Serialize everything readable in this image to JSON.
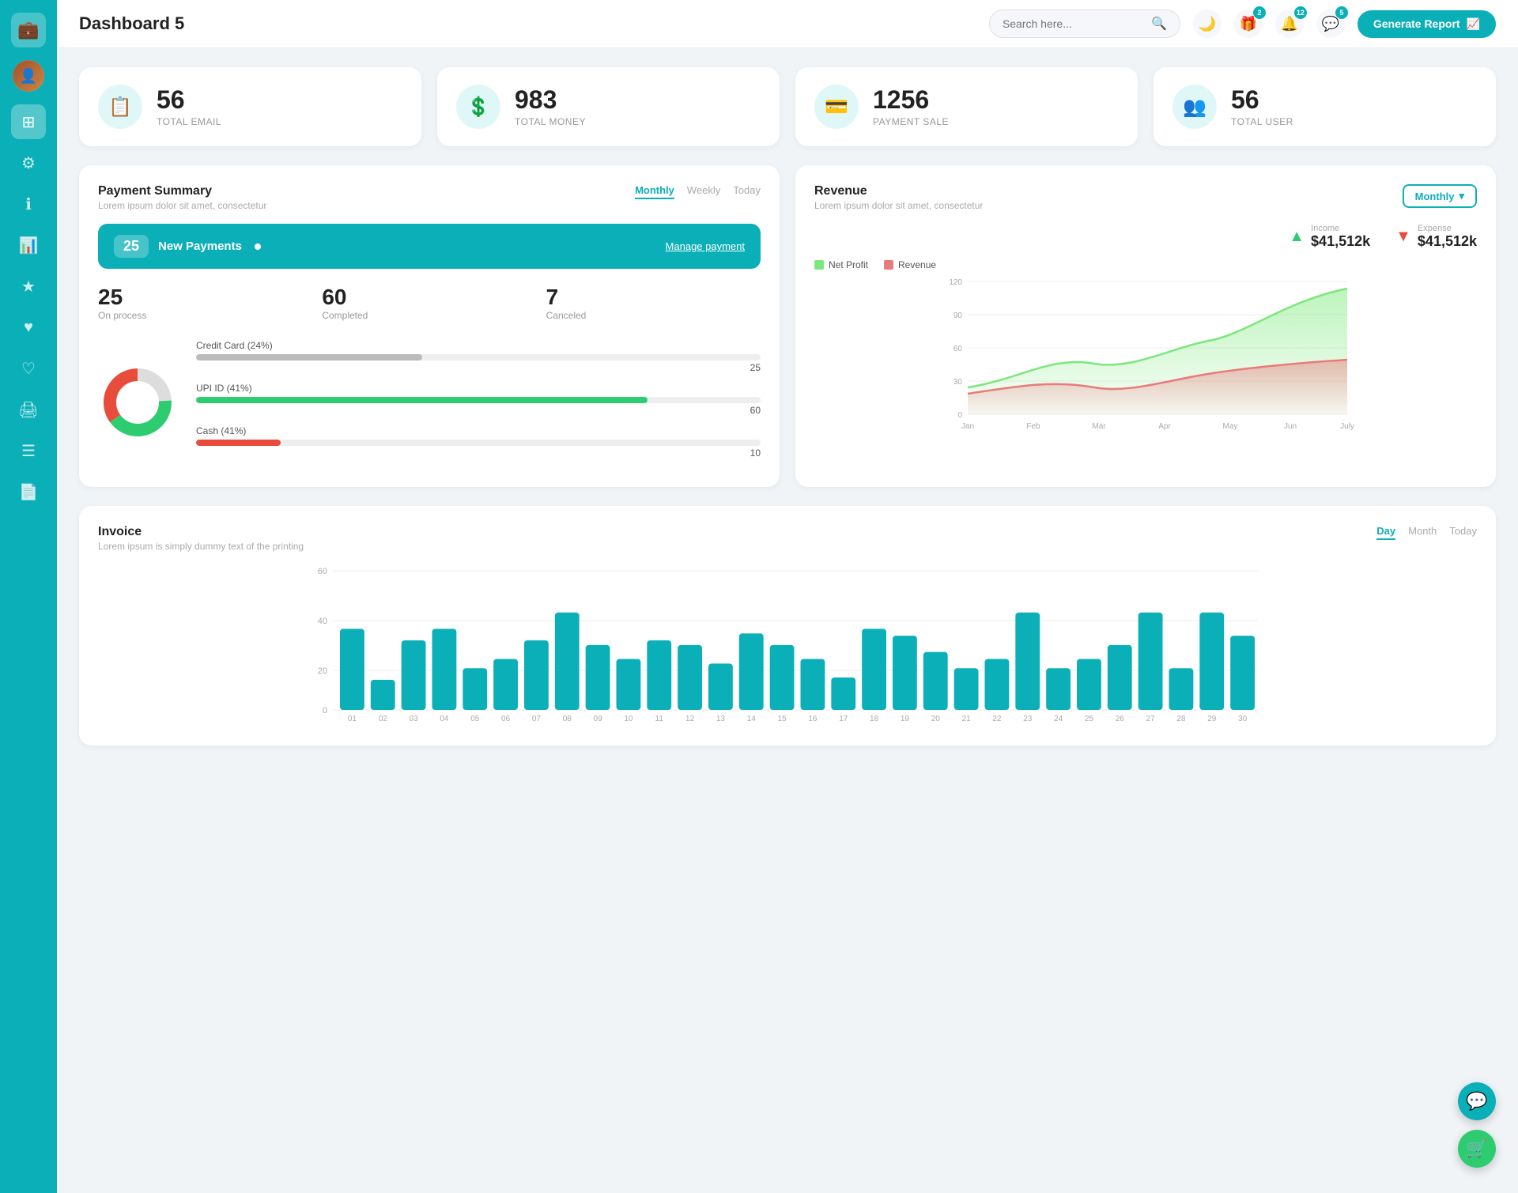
{
  "app": {
    "title": "Dashboard 5",
    "generate_btn": "Generate Report"
  },
  "search": {
    "placeholder": "Search here..."
  },
  "header_badges": {
    "gift": "2",
    "bell": "12",
    "chat": "5"
  },
  "stat_cards": [
    {
      "id": "total-email",
      "icon": "📋",
      "number": "56",
      "label": "TOTAL EMAIL"
    },
    {
      "id": "total-money",
      "icon": "💲",
      "number": "983",
      "label": "TOTAL MONEY"
    },
    {
      "id": "payment-sale",
      "icon": "💳",
      "number": "1256",
      "label": "PAYMENT SALE"
    },
    {
      "id": "total-user",
      "icon": "👥",
      "number": "56",
      "label": "TOTAL USER"
    }
  ],
  "payment_summary": {
    "title": "Payment Summary",
    "subtitle": "Lorem ipsum dolor sit amet, consectetur",
    "tabs": [
      "Monthly",
      "Weekly",
      "Today"
    ],
    "active_tab": "Monthly",
    "new_payments_count": "25",
    "new_payments_label": "New Payments",
    "manage_link": "Manage payment",
    "stats": [
      {
        "number": "25",
        "label": "On process"
      },
      {
        "number": "60",
        "label": "Completed"
      },
      {
        "number": "7",
        "label": "Canceled"
      }
    ],
    "bars": [
      {
        "label": "Credit Card (24%)",
        "percent": 40,
        "color": "#aaa",
        "value": "25"
      },
      {
        "label": "UPI ID (41%)",
        "percent": 80,
        "color": "#2ecc71",
        "value": "60"
      },
      {
        "label": "Cash (41%)",
        "percent": 15,
        "color": "#e74c3c",
        "value": "10"
      }
    ],
    "donut": {
      "segments": [
        {
          "color": "#aaa",
          "percent": 24
        },
        {
          "color": "#2ecc71",
          "percent": 41
        },
        {
          "color": "#e74c3c",
          "percent": 35
        }
      ]
    }
  },
  "revenue": {
    "title": "Revenue",
    "subtitle": "Lorem ipsum dolor sit amet, consectetur",
    "dropdown": "Monthly",
    "income_label": "Income",
    "income_amount": "$41,512k",
    "expense_label": "Expense",
    "expense_amount": "$41,512k",
    "legend": [
      {
        "label": "Net Profit",
        "color": "#7be87b"
      },
      {
        "label": "Revenue",
        "color": "#e87b7b"
      }
    ],
    "x_labels": [
      "Jan",
      "Feb",
      "Mar",
      "Apr",
      "May",
      "Jun",
      "July"
    ],
    "y_labels": [
      "0",
      "30",
      "60",
      "90",
      "120"
    ]
  },
  "invoice": {
    "title": "Invoice",
    "subtitle": "Lorem ipsum is simply dummy text of the printing",
    "tabs": [
      "Day",
      "Month",
      "Today"
    ],
    "active_tab": "Day",
    "x_labels": [
      "01",
      "02",
      "03",
      "04",
      "05",
      "06",
      "07",
      "08",
      "09",
      "10",
      "11",
      "12",
      "13",
      "14",
      "15",
      "16",
      "17",
      "18",
      "19",
      "20",
      "21",
      "22",
      "23",
      "24",
      "25",
      "26",
      "27",
      "28",
      "29",
      "30"
    ],
    "y_labels": [
      "0",
      "20",
      "40",
      "60"
    ],
    "bars": [
      35,
      13,
      30,
      35,
      18,
      22,
      30,
      42,
      28,
      22,
      30,
      28,
      20,
      33,
      28,
      22,
      14,
      35,
      32,
      25,
      18,
      22,
      42,
      18,
      22,
      28,
      42,
      18,
      42,
      32
    ]
  },
  "sidebar": {
    "items": [
      {
        "id": "wallet",
        "icon": "💼",
        "active": true
      },
      {
        "id": "dashboard",
        "icon": "⊞",
        "active": false
      },
      {
        "id": "settings",
        "icon": "⚙",
        "active": false
      },
      {
        "id": "info",
        "icon": "ℹ",
        "active": false
      },
      {
        "id": "chart",
        "icon": "📊",
        "active": false
      },
      {
        "id": "star",
        "icon": "★",
        "active": false
      },
      {
        "id": "heart",
        "icon": "♥",
        "active": false
      },
      {
        "id": "heart2",
        "icon": "♡",
        "active": false
      },
      {
        "id": "print",
        "icon": "🖨",
        "active": false
      },
      {
        "id": "list",
        "icon": "☰",
        "active": false
      },
      {
        "id": "doc",
        "icon": "📄",
        "active": false
      }
    ]
  },
  "fab": {
    "support_icon": "💬",
    "cart_icon": "🛒"
  }
}
